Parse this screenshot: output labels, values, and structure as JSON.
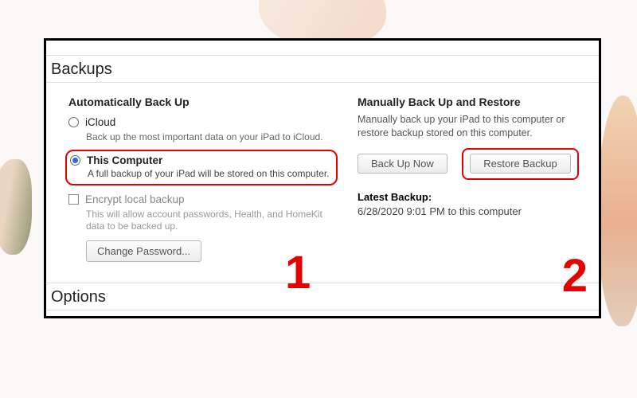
{
  "sections": {
    "backups_title": "Backups",
    "options_title": "Options"
  },
  "auto_backup": {
    "title": "Automatically Back Up",
    "icloud": {
      "label": "iCloud",
      "description": "Back up the most important data on your iPad to iCloud."
    },
    "this_computer": {
      "label": "This Computer",
      "description": "A full backup of your iPad will be stored on this computer."
    },
    "encrypt": {
      "label": "Encrypt local backup",
      "description": "This will allow account passwords, Health, and HomeKit data to be backed up."
    },
    "change_password_label": "Change Password..."
  },
  "manual": {
    "title": "Manually Back Up and Restore",
    "description": "Manually back up your iPad to this computer or restore backup stored on this computer.",
    "back_up_now_label": "Back Up Now",
    "restore_backup_label": "Restore Backup"
  },
  "latest_backup": {
    "label": "Latest Backup:",
    "value": "6/28/2020 9:01 PM to this computer"
  },
  "annotations": {
    "num1": "1",
    "num2": "2"
  }
}
